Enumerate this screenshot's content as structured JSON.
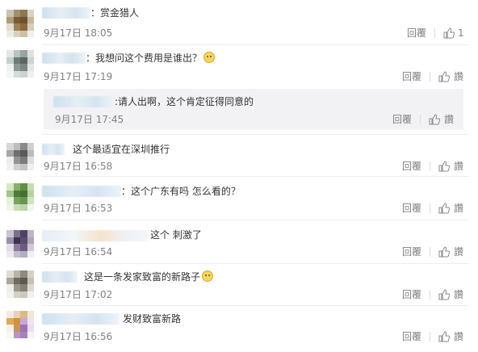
{
  "comments": [
    {
      "text": "：赏金猎人",
      "time": "9月17日 18:05",
      "reply": "回覆",
      "likes": "1",
      "avatar": [
        "#c9c2b6",
        "#a68f6b",
        "#8d7650",
        "#d9d2c3",
        "#b19a74",
        "#7a5a35",
        "#6d5230",
        "#c7b79b",
        "#e2dcd1",
        "#9b8154",
        "#8b6a3f",
        "#d5cdbd",
        "#efece6",
        "#d8cfbf",
        "#cdbfa6",
        "#f3f0ea"
      ]
    },
    {
      "text": "：我想问这个费用是谁出？",
      "time": "9月17日 17:19",
      "reply": "回覆",
      "like_label": "讚",
      "avatar": [
        "#e4e7e6",
        "#b9c3c0",
        "#98a4a2",
        "#dde2e1",
        "#c8d0ce",
        "#6e7b79",
        "#5c6765",
        "#cdd4d2",
        "#f0f2f1",
        "#8d9896",
        "#7b8784",
        "#e2e6e5",
        "#f4f5f5",
        "#d5dbda",
        "#cbd2d0",
        "#eef0ef"
      ]
    },
    {
      "text": ":请人出啊，这个肯定征得同意的",
      "time": "9月17日 17:45",
      "reply": "回覆",
      "like_label": "讚"
    },
    {
      "text": "这个最适宜在深圳推行",
      "time": "9月17日 16:58",
      "reply": "回覆",
      "like_label": "讚",
      "avatar": [
        "#d9d9d9",
        "#bdbdbd",
        "#8a8a8a",
        "#cfcfcf",
        "#a7a7a7",
        "#6f6f6f",
        "#5a5a5a",
        "#bcbcbc",
        "#ededed",
        "#949494",
        "#7c7c7c",
        "#dedede",
        "#f2f2f2",
        "#d0d0d0",
        "#c4c4c4",
        "#f0f0f0"
      ]
    },
    {
      "text": "：这个广东有吗 怎么看的？",
      "time": "9月17日 16:53",
      "reply": "回覆",
      "like_label": "讚",
      "avatar": [
        "#d6e8c8",
        "#86b06a",
        "#5f8f45",
        "#c5dcb3",
        "#a3c58a",
        "#4f7a38",
        "#467033",
        "#b5d19f",
        "#e6f0dc",
        "#78a35c",
        "#6a9550",
        "#d1e4c1",
        "#eef5e8",
        "#c9ddb8",
        "#bdd5a8",
        "#f2f7ee"
      ]
    },
    {
      "text": "这个 刺激了",
      "time": "9月17日 16:54",
      "reply": "回覆",
      "like_label": "讚",
      "avatar": [
        "#c9c4cf",
        "#7d6f8c",
        "#4e4262",
        "#bdb5c6",
        "#9c8fab",
        "#3d3152",
        "#5a4b70",
        "#b0a6bb",
        "#e2dee6",
        "#8a7b9b",
        "#6c5d80",
        "#d0cad6",
        "#eceaef",
        "#c3bccb",
        "#b6aec0",
        "#f1eff3"
      ]
    },
    {
      "text": "这是一条发家致富的新路子",
      "time": "9月17日 17:02",
      "reply": "回覆",
      "like_label": "讚",
      "avatar": [
        "#dedcd6",
        "#b8b4a8",
        "#8e8a7e",
        "#d3d0c7",
        "#aaa69a",
        "#6f6b60",
        "#5e5a50",
        "#c4c1b6",
        "#efeee9",
        "#9a968a",
        "#858176",
        "#dcd9d1",
        "#f3f2ef",
        "#d4d1c9",
        "#cbc8be",
        "#f2f1ed"
      ]
    },
    {
      "text": "发财致富新路",
      "time": "9月17日 16:56",
      "reply": "回覆",
      "like_label": "讚",
      "avatar": [
        "#f1ede6",
        "#e7d2b1",
        "#d9b98a",
        "#efe6d8",
        "#e0a85a",
        "#d48f3a",
        "#c8a9d4",
        "#efe3f3",
        "#f5f0e9",
        "#c79555",
        "#9a74b3",
        "#e9ddef",
        "#faf7f2",
        "#b993cc",
        "#a782bf",
        "#f7f2f9"
      ]
    }
  ]
}
